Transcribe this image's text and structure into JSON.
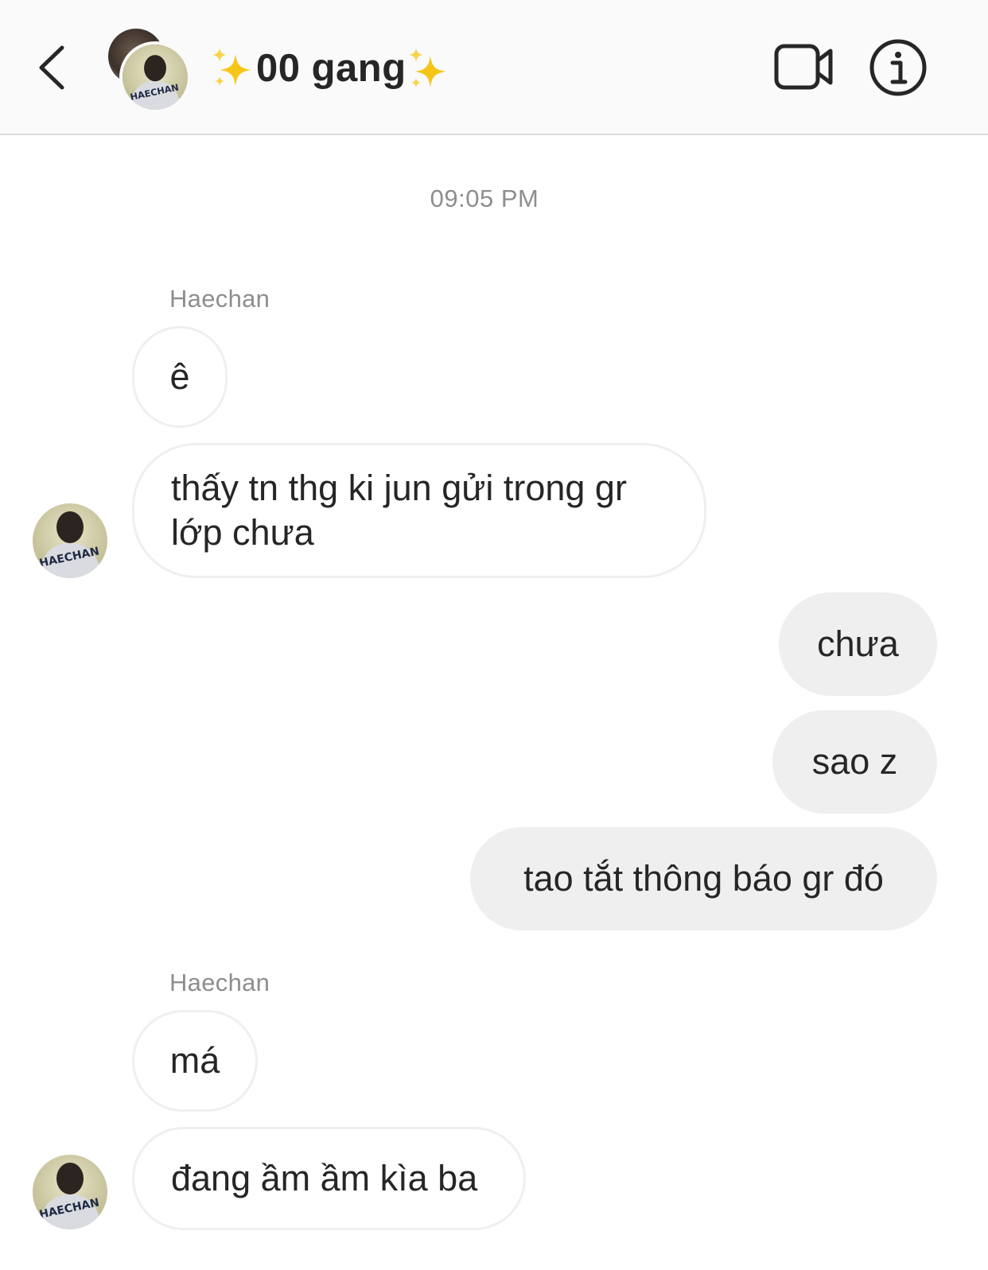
{
  "header": {
    "title": "00 gang",
    "back_icon": "chevron-left-icon",
    "video_icon": "video-camera-icon",
    "info_icon": "info-icon"
  },
  "chat": {
    "timestamp": "09:05 PM",
    "groups": [
      {
        "sender": "Haechan",
        "messages": [
          "ê",
          "thấy tn thg ki jun gửi trong gr lớp chưa"
        ]
      },
      {
        "sender": "me",
        "messages": [
          "chưa",
          "sao z",
          "tao tắt thông báo gr đó"
        ]
      },
      {
        "sender": "Haechan",
        "messages": [
          "má",
          "đang ầm ầm kìa ba"
        ]
      }
    ]
  },
  "avatar_jersey_text": "HAECHAN",
  "colors": {
    "header_bg": "#fafafa",
    "incoming_border": "#efefef",
    "outgoing_bg": "#efefef",
    "meta_text": "#8e8e8e",
    "sparkle": "#f5c518"
  }
}
